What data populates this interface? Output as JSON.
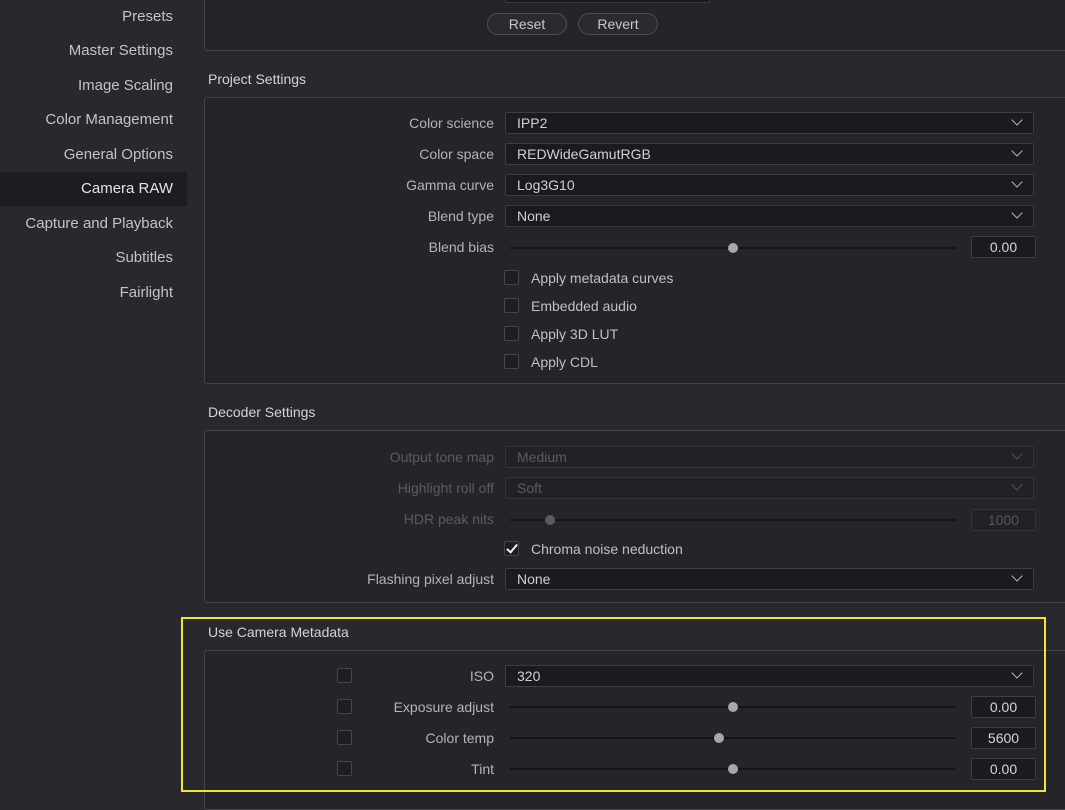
{
  "sidebar": {
    "items": [
      {
        "label": "Presets"
      },
      {
        "label": "Master Settings"
      },
      {
        "label": "Image Scaling"
      },
      {
        "label": "Color Management"
      },
      {
        "label": "General Options"
      },
      {
        "label": "Camera RAW"
      },
      {
        "label": "Capture and Playback"
      },
      {
        "label": "Subtitles"
      },
      {
        "label": "Fairlight"
      }
    ],
    "active": "Camera RAW"
  },
  "top_buttons": {
    "reset": "Reset",
    "revert": "Revert"
  },
  "project_settings": {
    "title": "Project Settings",
    "color_science": {
      "label": "Color science",
      "value": "IPP2"
    },
    "color_space": {
      "label": "Color space",
      "value": "REDWideGamutRGB"
    },
    "gamma_curve": {
      "label": "Gamma curve",
      "value": "Log3G10"
    },
    "blend_type": {
      "label": "Blend type",
      "value": "None"
    },
    "blend_bias": {
      "label": "Blend bias",
      "value": "0.00",
      "fraction": 0.5
    },
    "checkboxes": [
      {
        "label": "Apply metadata curves",
        "checked": false
      },
      {
        "label": "Embedded audio",
        "checked": false
      },
      {
        "label": "Apply 3D LUT",
        "checked": false
      },
      {
        "label": "Apply CDL",
        "checked": false
      }
    ]
  },
  "decoder_settings": {
    "title": "Decoder Settings",
    "output_tone_map": {
      "label": "Output tone map",
      "value": "Medium"
    },
    "highlight_roll_off": {
      "label": "Highlight roll off",
      "value": "Soft"
    },
    "hdr_peak_nits": {
      "label": "HDR peak nits",
      "value": "1000",
      "fraction": 0.09
    },
    "chroma_noise": {
      "label": "Chroma noise neduction",
      "checked": true
    },
    "flashing_pixel": {
      "label": "Flashing pixel adjust",
      "value": "None"
    }
  },
  "camera_metadata": {
    "title": "Use Camera Metadata",
    "iso": {
      "label": "ISO",
      "value": "320"
    },
    "exposure": {
      "label": "Exposure adjust",
      "value": "0.00",
      "fraction": 0.5
    },
    "color_temp": {
      "label": "Color temp",
      "value": "5600",
      "fraction": 0.47
    },
    "tint": {
      "label": "Tint",
      "value": "0.00",
      "fraction": 0.5
    }
  },
  "colors": {
    "highlight": "#f2e431",
    "background": "#28282e",
    "active_item": "#1c1c21"
  }
}
